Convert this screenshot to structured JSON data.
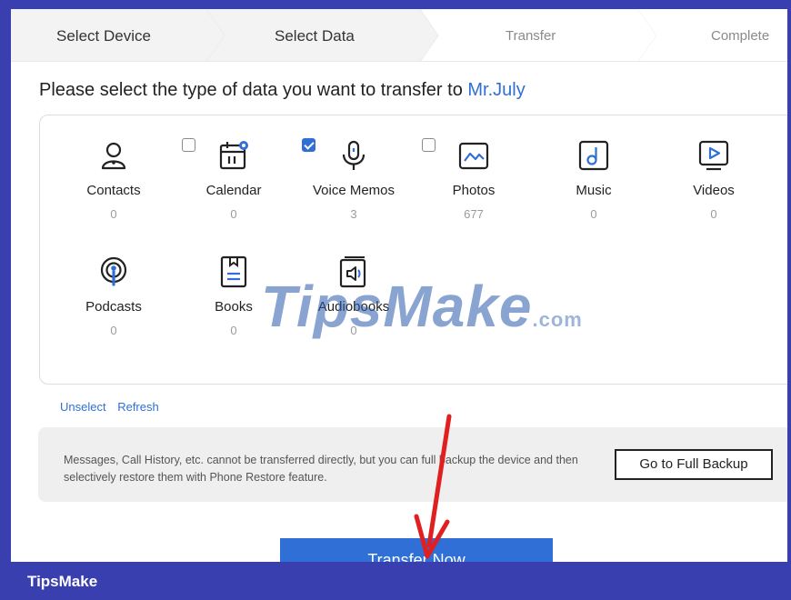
{
  "steps": [
    {
      "label": "Select Device",
      "state": "done"
    },
    {
      "label": "Select Data",
      "state": "active"
    },
    {
      "label": "Transfer",
      "state": "pending"
    },
    {
      "label": "Complete",
      "state": "pending"
    }
  ],
  "heading": {
    "prefix": "Please select the type of data you want to transfer to ",
    "target": "Mr.July"
  },
  "data_types": [
    {
      "name": "Contacts",
      "count": "0",
      "icon": "contacts-icon",
      "checkbox": null
    },
    {
      "name": "Calendar",
      "count": "0",
      "icon": "calendar-icon",
      "checkbox": false
    },
    {
      "name": "Voice Memos",
      "count": "3",
      "icon": "microphone-icon",
      "checkbox": true
    },
    {
      "name": "Photos",
      "count": "677",
      "icon": "photos-icon",
      "checkbox": false
    },
    {
      "name": "Music",
      "count": "0",
      "icon": "music-icon",
      "checkbox": null
    },
    {
      "name": "Videos",
      "count": "0",
      "icon": "videos-icon",
      "checkbox": null
    },
    {
      "name": "Podcasts",
      "count": "0",
      "icon": "podcasts-icon",
      "checkbox": null
    },
    {
      "name": "Books",
      "count": "0",
      "icon": "books-icon",
      "checkbox": null
    },
    {
      "name": "Audiobooks",
      "count": "0",
      "icon": "audiobooks-icon",
      "checkbox": null
    }
  ],
  "links": {
    "unselect": "Unselect",
    "refresh": "Refresh"
  },
  "notice": {
    "message": "Messages, Call History, etc. cannot be transferred directly, but you can full backup the device and then selectively restore them with Phone Restore feature.",
    "button": "Go to Full Backup"
  },
  "primary_button": "Transfer Now",
  "watermark": {
    "main": "TipsMake",
    "suffix": ".com"
  },
  "footer": {
    "brand": "TipsMake"
  },
  "colors": {
    "accent": "#2f6fd6",
    "frame": "#3a3fb0",
    "arrow": "#e02020"
  }
}
